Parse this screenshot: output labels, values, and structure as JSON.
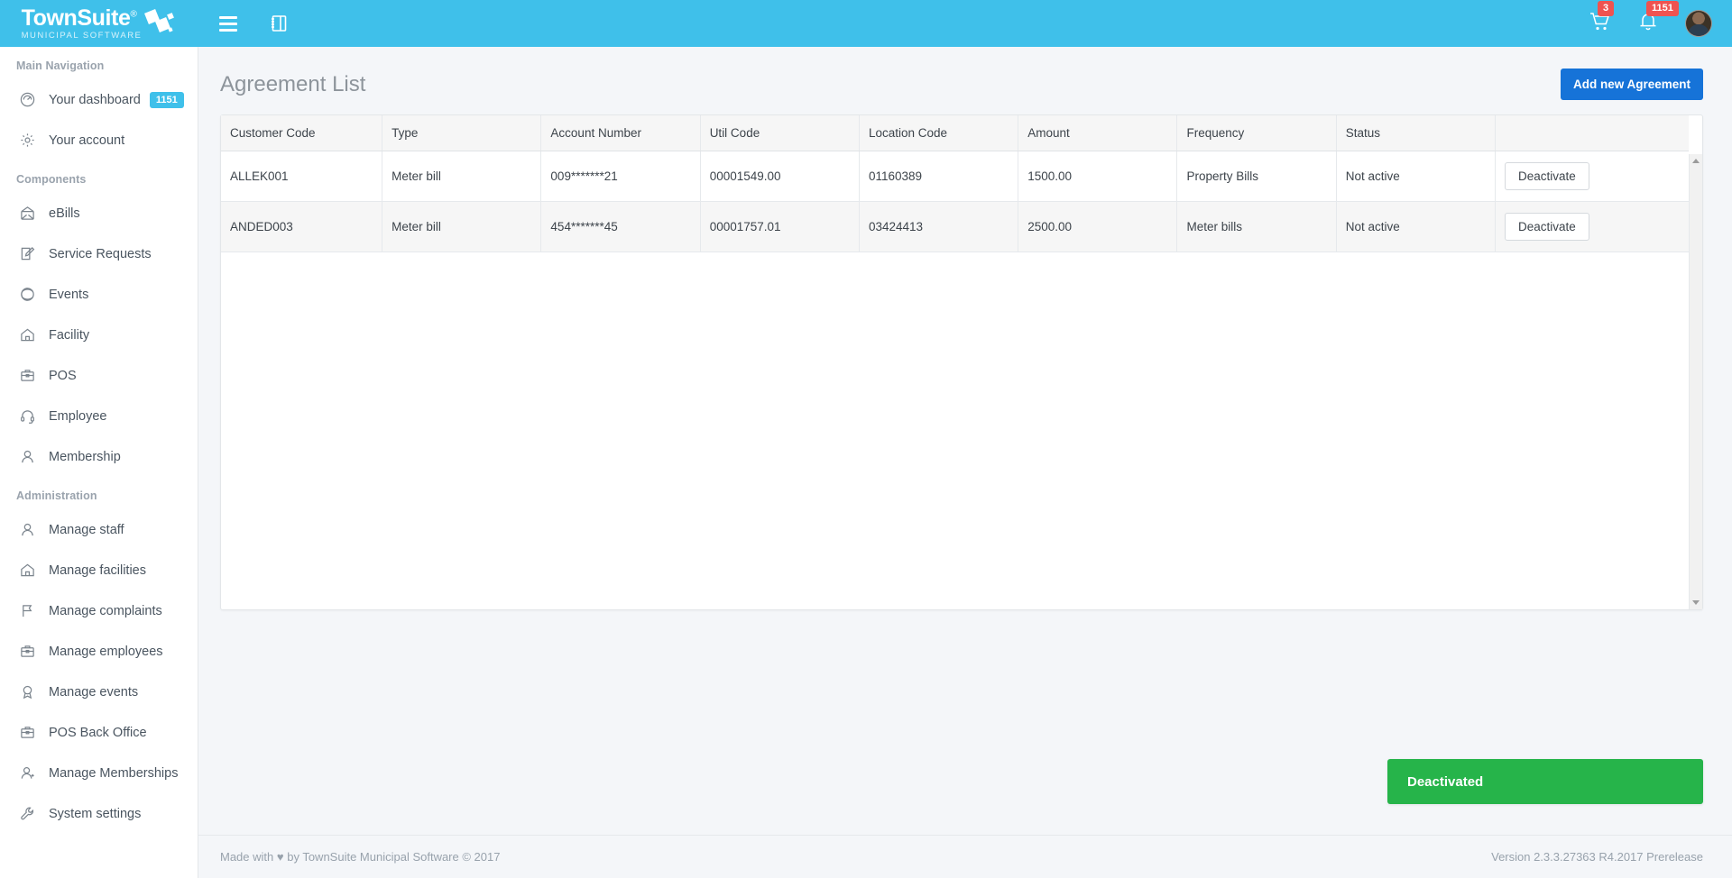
{
  "topbar": {
    "logo_main": "TownSuite",
    "logo_reg": "®",
    "logo_sub": "MUNICIPAL SOFTWARE",
    "menu_icon": "hamburger-icon",
    "panel_icon": "book-panel-icon",
    "cart_badge": "3",
    "bell_badge": "1151"
  },
  "sidebar": {
    "sections": [
      {
        "heading": "Main Navigation",
        "items": [
          {
            "label": "Your dashboard",
            "icon": "gauge-icon",
            "badge": "1151"
          },
          {
            "label": "Your account",
            "icon": "gear-icon",
            "badge": ""
          }
        ]
      },
      {
        "heading": "Components",
        "items": [
          {
            "label": "eBills",
            "icon": "envelope-icon",
            "badge": ""
          },
          {
            "label": "Service Requests",
            "icon": "pencil-square-icon",
            "badge": ""
          },
          {
            "label": "Events",
            "icon": "ball-icon",
            "badge": ""
          },
          {
            "label": "Facility",
            "icon": "home-icon",
            "badge": ""
          },
          {
            "label": "POS",
            "icon": "briefcase-icon",
            "badge": ""
          },
          {
            "label": "Employee",
            "icon": "headset-icon",
            "badge": ""
          },
          {
            "label": "Membership",
            "icon": "person-icon",
            "badge": ""
          }
        ]
      },
      {
        "heading": "Administration",
        "items": [
          {
            "label": "Manage staff",
            "icon": "person-icon",
            "badge": ""
          },
          {
            "label": "Manage facilities",
            "icon": "home-icon",
            "badge": ""
          },
          {
            "label": "Manage complaints",
            "icon": "flag-icon",
            "badge": ""
          },
          {
            "label": "Manage employees",
            "icon": "briefcase-icon",
            "badge": ""
          },
          {
            "label": "Manage events",
            "icon": "award-icon",
            "badge": ""
          },
          {
            "label": "POS Back Office",
            "icon": "briefcase-icon",
            "badge": ""
          },
          {
            "label": "Manage Memberships",
            "icon": "person-plus-icon",
            "badge": ""
          },
          {
            "label": "System settings",
            "icon": "wrench-icon",
            "badge": ""
          }
        ]
      }
    ]
  },
  "page": {
    "title": "Agreement List",
    "add_button": "Add new Agreement"
  },
  "table": {
    "columns": [
      "Customer Code",
      "Type",
      "Account Number",
      "Util Code",
      "Location Code",
      "Amount",
      "Frequency",
      "Status",
      ""
    ],
    "rows": [
      {
        "customer_code": "ALLEK001",
        "type": "Meter bill",
        "account_number": "009*******21",
        "util_code": "00001549.00",
        "location_code": "01160389",
        "amount": "1500.00",
        "frequency": "Property Bills",
        "status": "Not active",
        "action": "Deactivate"
      },
      {
        "customer_code": "ANDED003",
        "type": "Meter bill",
        "account_number": "454*******45",
        "util_code": "00001757.01",
        "location_code": "03424413",
        "amount": "2500.00",
        "frequency": "Meter bills",
        "status": "Not active",
        "action": "Deactivate"
      }
    ]
  },
  "toast": {
    "message": "Deactivated",
    "color": "#26b44a"
  },
  "footer": {
    "left_prefix": "Made with",
    "heart": "♥",
    "left_suffix": "by TownSuite Municipal Software © 2017",
    "version": "Version 2.3.3.27363 R4.2017 Prerelease"
  },
  "colors": {
    "brand": "#3fc0ea",
    "primary": "#1673d8",
    "success": "#26b44a",
    "danger": "#ef5350"
  }
}
